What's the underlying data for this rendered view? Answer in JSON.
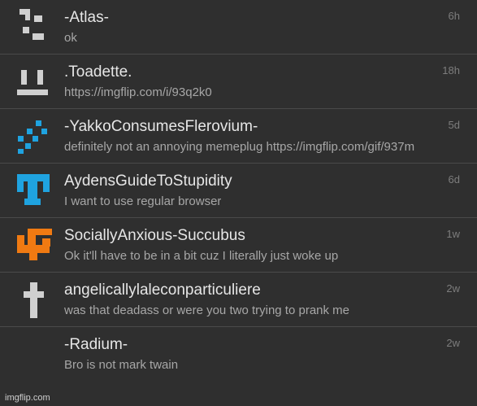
{
  "conversations": [
    {
      "name": "-Atlas-",
      "message": "ok",
      "time": "6h",
      "avatar": "atlas-avatar-icon",
      "color": "#d0d0d0"
    },
    {
      "name": ".Toadette.",
      "message": "https://imgflip.com/i/93q2k0",
      "time": "18h",
      "avatar": "toadette-avatar-icon",
      "color": "#d0d0d0"
    },
    {
      "name": "-YakkoConsumesFlerovium-",
      "message": "definitely not an annoying memeplug https://imgflip.com/gif/937m",
      "time": "5d",
      "avatar": "yakko-avatar-icon",
      "color": "#1fa3e0"
    },
    {
      "name": "AydensGuideToStupidity",
      "message": "I want to use regular browser",
      "time": "6d",
      "avatar": "ayden-avatar-icon",
      "color": "#1fa3e0"
    },
    {
      "name": "SociallyAnxious-Succubus",
      "message": "Ok it'll have to be in a bit cuz I literally just woke up",
      "time": "1w",
      "avatar": "succubus-avatar-icon",
      "color": "#f07a12"
    },
    {
      "name": "angelicallylaleconparticuliere",
      "message": "was that deadass or were you two trying to prank me",
      "time": "2w",
      "avatar": "cross-avatar-icon",
      "color": "#d0d0d0"
    },
    {
      "name": "-Radium-",
      "message": "Bro is not mark twain",
      "time": "2w",
      "avatar": "",
      "color": ""
    }
  ],
  "watermark": "imgflip.com"
}
